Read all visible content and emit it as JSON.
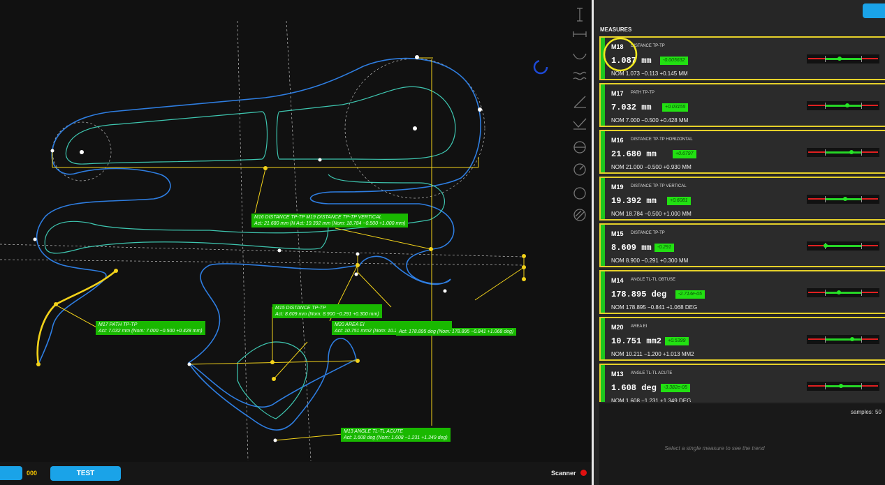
{
  "bottom_bar": {
    "counter": "000",
    "test_label": "TEST",
    "scanner_label": "Scanner"
  },
  "panel": {
    "heading": "MEASURES",
    "samples_label": "samples:",
    "samples_value": "50",
    "trend_hint": "Select a single measure to see the trend"
  },
  "measures": [
    {
      "id": "M18",
      "type": "DISTANCE TP-TP",
      "value": "1.087 mm",
      "deviation": "-0.005632",
      "nominal": "NOM 1.073 −0.113 +0.145 MM",
      "gauge_position": 0.45
    },
    {
      "id": "M17",
      "type": "PATH TP-TP",
      "value": "7.032 mm",
      "deviation": "+0.03155",
      "nominal": "NOM 7.000 −0.500 +0.428 MM",
      "gauge_position": 0.56
    },
    {
      "id": "M16",
      "type": "DISTANCE TP-TP HORIZONTAL",
      "value": "21.680 mm",
      "deviation": "+0.6797",
      "nominal": "NOM 21.000 −0.500 +0.930 MM",
      "gauge_position": 0.62
    },
    {
      "id": "M19",
      "type": "DISTANCE TP-TP VERTICAL",
      "value": "19.392 mm",
      "deviation": "+0.6081",
      "nominal": "NOM 18.784 −0.500 +1.000 MM",
      "gauge_position": 0.53
    },
    {
      "id": "M15",
      "type": "DISTANCE TP-TP",
      "value": "8.609 mm",
      "deviation": "-0.291",
      "nominal": "NOM 8.900 −0.291 +0.300 MM",
      "gauge_position": 0.25
    },
    {
      "id": "M14",
      "type": "ANGLE TL-TL OBTUSE",
      "value": "178.895 deg",
      "deviation": "-2.714e-05",
      "nominal": "NOM 178.895 −0.841 +1.068 DEG",
      "gauge_position": 0.44
    },
    {
      "id": "M20",
      "type": "AREA EI",
      "value": "10.751 mm2",
      "deviation": "+0.5399",
      "nominal": "NOM 10.211 −1.200 +1.013 MM2",
      "gauge_position": 0.63
    },
    {
      "id": "M13",
      "type": "ANGLE TL-TL ACUTE",
      "value": "1.608 deg",
      "deviation": "-3.382e-05",
      "nominal": "NOM 1.608 −1.231 +1.349 DEG",
      "gauge_position": 0.47
    }
  ],
  "callouts": [
    {
      "line1": "M16  DISTANCE TP-TP  M19  DISTANCE TP-TP VERTICAL",
      "line2": "Act: 21.680 mm  (N  Act: 19.392 mm  (Nom: 18.784 −0.500 +1.000 mm)"
    },
    {
      "line1": "M15  DISTANCE TP-TP",
      "line2": "Act: 8.609 mm  (Nom: 8.900 −0.291 +0.300 mm)"
    },
    {
      "line1": "M20  AREA EI",
      "line2": "Act: 10.751 mm2  (Nom: 10.211 −1.200 +1.013 mm2)"
    },
    {
      "line1": "",
      "line2": "Act: 178.895 deg  (Nom: 178.895 −0.841 +1.068 deg)"
    },
    {
      "line1": "M17  PATH TP-TP",
      "line2": "Act: 7.032 mm  (Nom: 7.000 −0.500 +0.428 mm)"
    },
    {
      "line1": "M13  ANGLE TL-TL ACUTE",
      "line2": "Act: 1.608 deg  (Nom: 1.608 −1.231 +1.349 deg)"
    }
  ],
  "icons": [
    "vertical-distance-icon",
    "horizontal-distance-icon",
    "arc-icon",
    "wave-icon",
    "angle-icon",
    "angle-check-icon",
    "circle-line-icon",
    "gauge-icon",
    "circle-icon",
    "hatch-icon"
  ],
  "colors": {
    "accent": "#1aa3e8",
    "highlight": "#e6d12a",
    "ok": "#1ec61e",
    "alarm": "#e01010"
  }
}
